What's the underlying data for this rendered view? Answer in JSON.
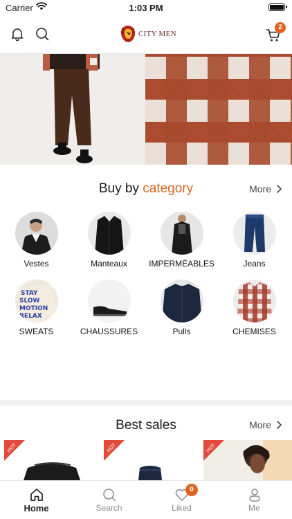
{
  "status_bar": {
    "carrier": "Carrier",
    "time": "1:03 PM"
  },
  "header": {
    "logo_text": "CITY MEN",
    "cart_count": "2"
  },
  "categories_section": {
    "title_prefix": "Buy by",
    "title_accent": "category",
    "more_label": "More",
    "items": [
      {
        "label": "Vestes"
      },
      {
        "label": "Manteaux"
      },
      {
        "label": "IMPERMÉABLES"
      },
      {
        "label": "Jeans"
      },
      {
        "label": "SWEATS"
      },
      {
        "label": "CHAUSSURES"
      },
      {
        "label": "Pulls"
      },
      {
        "label": "CHEMISES"
      }
    ]
  },
  "best_sales": {
    "title": "Best sales",
    "more_label": "More",
    "hot_badge": "HOT"
  },
  "tabbar": {
    "tabs": [
      {
        "label": "Home",
        "icon": "home-icon"
      },
      {
        "label": "Search",
        "icon": "search-icon"
      },
      {
        "label": "Liked",
        "icon": "heart-icon",
        "badge": "0"
      },
      {
        "label": "Me",
        "icon": "person-icon"
      }
    ]
  },
  "colors": {
    "accent": "#e2631f",
    "title_accent": "#d9641f"
  }
}
